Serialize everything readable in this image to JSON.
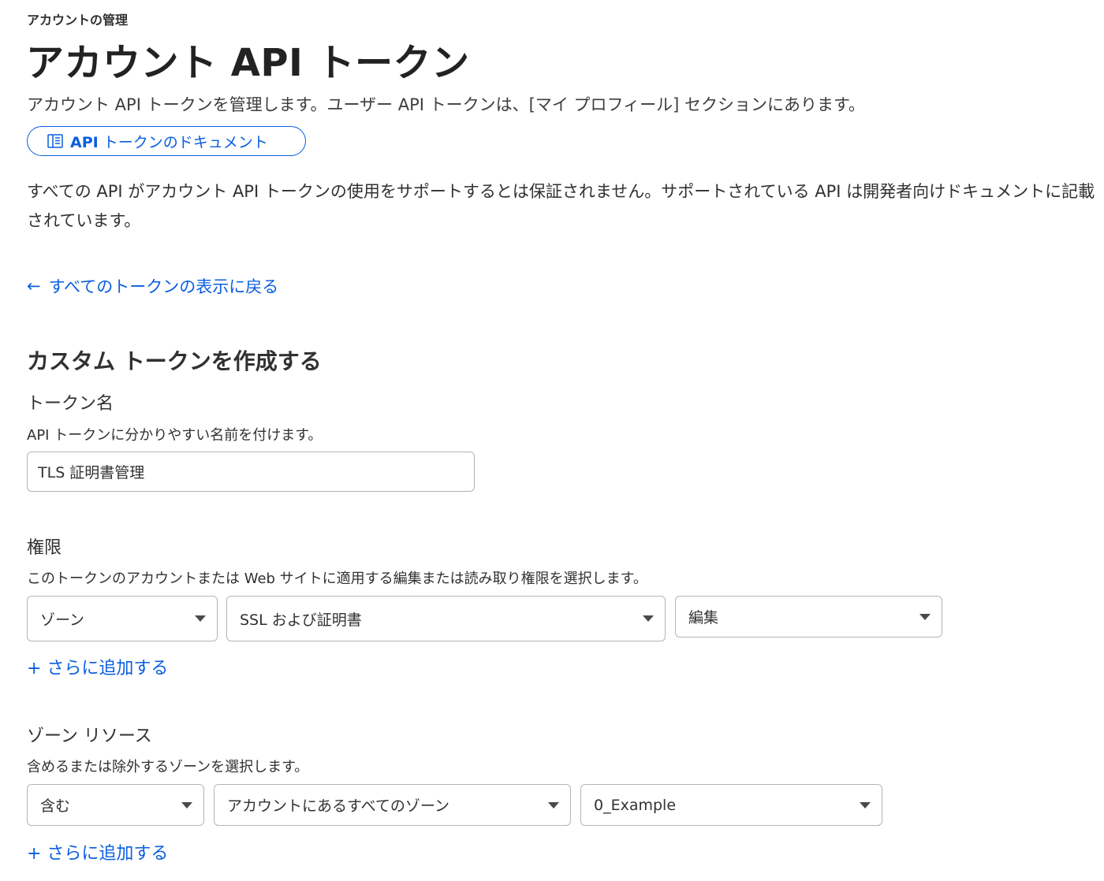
{
  "breadcrumb": "アカウントの管理",
  "page_title": "アカウント API トークン",
  "subtitle": "アカウント API トークンを管理します。ユーザー API トークンは、[マイ プロフィール] セクションにあります。",
  "doc_button": {
    "bold": "API",
    "label": " トークンのドキュメント",
    "icon": "book-icon"
  },
  "note": "すべての API がアカウント API トークンの使用をサポートするとは保証されません。サポートされている API は開発者向けドキュメントに記載されています。",
  "back_link": {
    "arrow": "←",
    "label": "すべてのトークンの表示に戻る"
  },
  "section_title": "カスタム トークンを作成する",
  "token_name": {
    "label": "トークン名",
    "description": "API トークンに分かりやすい名前を付けます。",
    "value": "TLS 証明書管理"
  },
  "permissions": {
    "label": "権限",
    "description": "このトークンのアカウントまたは Web サイトに適用する編集または読み取り権限を選択します。",
    "scope": "ゾーン",
    "resource": "SSL および証明書",
    "access": "編集",
    "add_more": "+ さらに追加する"
  },
  "zone_resources": {
    "label": "ゾーン リソース",
    "description": "含めるまたは除外するゾーンを選択します。",
    "mode": "含む",
    "target": "アカウントにあるすべてのゾーン",
    "zone": "0_Example",
    "add_more": "+ さらに追加する"
  },
  "colors": {
    "accent": "#0a5ee0",
    "text": "#313131",
    "border": "#b5b5b5"
  }
}
